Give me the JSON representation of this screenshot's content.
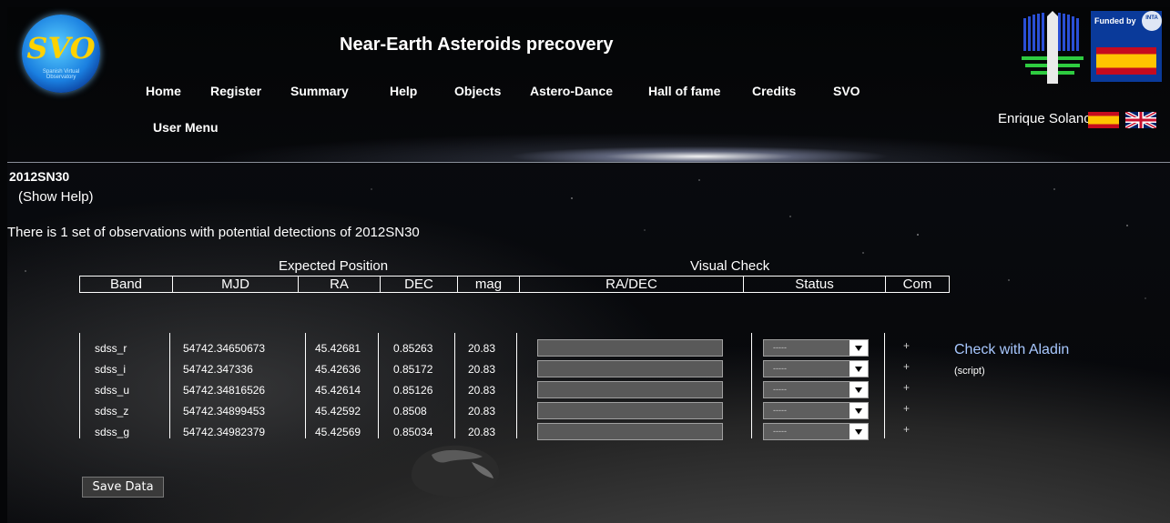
{
  "header": {
    "logo_text": "SVO",
    "logo_subtext": "Spanish Virtual Observatory",
    "site_title": "Near-Earth Asteroids precovery",
    "funded_text": "Funded by",
    "inta_text": "INTA",
    "user_name": "Enrique Solano"
  },
  "nav": {
    "items": [
      {
        "label": "Home"
      },
      {
        "label": "Register"
      },
      {
        "label": "Summary"
      },
      {
        "label": "Help"
      },
      {
        "label": "Objects"
      },
      {
        "label": "Astero-Dance"
      },
      {
        "label": "Hall of fame"
      },
      {
        "label": "Credits"
      },
      {
        "label": "SVO"
      },
      {
        "label": "User Menu"
      }
    ]
  },
  "main": {
    "object_name": "2012SN30",
    "show_help": "(Show Help)",
    "observations_sentence": "There is 1 set of observations with potential detections of 2012SN30",
    "group_expected": "Expected Position",
    "group_visual": "Visual Check",
    "columns": [
      "Band",
      "MJD",
      "RA",
      "DEC",
      "mag",
      "RA/DEC",
      "Status",
      "Com"
    ],
    "rows": [
      {
        "band": "sdss_r",
        "mjd": "54742.34650673",
        "ra": "45.42681",
        "dec": "0.85263",
        "mag": "20.83",
        "radec": "",
        "status": "-----",
        "com": "+"
      },
      {
        "band": "sdss_i",
        "mjd": "54742.347336",
        "ra": "45.42636",
        "dec": "0.85172",
        "mag": "20.83",
        "radec": "",
        "status": "-----",
        "com": "+"
      },
      {
        "band": "sdss_u",
        "mjd": "54742.34816526",
        "ra": "45.42614",
        "dec": "0.85126",
        "mag": "20.83",
        "radec": "",
        "status": "-----",
        "com": "+"
      },
      {
        "band": "sdss_z",
        "mjd": "54742.34899453",
        "ra": "45.42592",
        "dec": "0.8508",
        "mag": "20.83",
        "radec": "",
        "status": "-----",
        "com": "+"
      },
      {
        "band": "sdss_g",
        "mjd": "54742.34982379",
        "ra": "45.42569",
        "dec": "0.85034",
        "mag": "20.83",
        "radec": "",
        "status": "-----",
        "com": "+"
      }
    ],
    "aladin_link": "Check with Aladin",
    "script_link": "(script)",
    "save_button": "Save Data"
  }
}
